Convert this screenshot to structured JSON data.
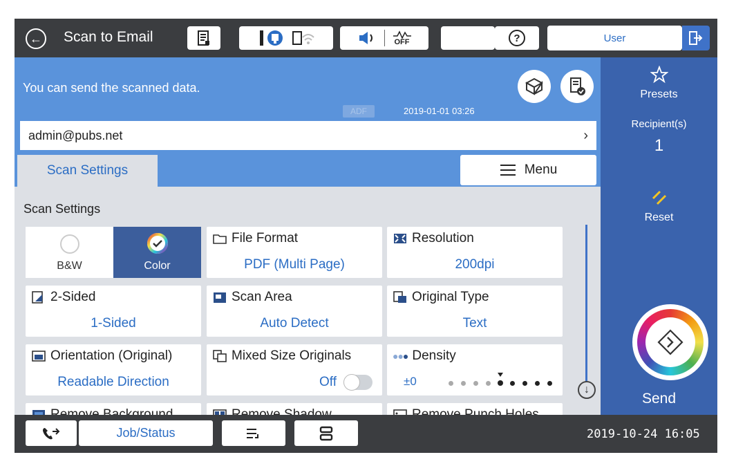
{
  "topbar": {
    "title": "Scan to Email",
    "user_label": "User",
    "icons": [
      "back-icon",
      "job-list-icon",
      "maintenance-icon",
      "wifi-icon",
      "volume-icon",
      "eco-off-icon",
      "sleep-icon",
      "help-icon",
      "logout-icon"
    ],
    "eco_off_text": "OFF"
  },
  "info": {
    "message": "You can send the scanned data.",
    "source_badge": "ADF",
    "datetime": "2019-01-01 03:26",
    "recipient": "admin@pubs.net"
  },
  "tabs": {
    "scan_settings": "Scan Settings",
    "menu": "Menu"
  },
  "settings": {
    "section_title": "Scan Settings",
    "color_mode": {
      "bw": "B&W",
      "color": "Color",
      "selected": "Color"
    },
    "tiles": [
      {
        "label": "File Format",
        "value": "PDF (Multi Page)",
        "icon": "folder-icon"
      },
      {
        "label": "Resolution",
        "value": "200dpi",
        "icon": "resolution-icon"
      },
      {
        "label": "2-Sided",
        "value": "1-Sided",
        "icon": "two-sided-icon"
      },
      {
        "label": "Scan Area",
        "value": "Auto Detect",
        "icon": "scan-area-icon"
      },
      {
        "label": "Original Type",
        "value": "Text",
        "icon": "original-type-icon"
      },
      {
        "label": "Orientation (Original)",
        "value": "Readable Direction",
        "icon": "orientation-icon"
      },
      {
        "label": "Mixed Size Originals",
        "value": "Off",
        "icon": "mixed-size-icon"
      },
      {
        "label": "Density",
        "value": "±0",
        "icon": "density-icon",
        "level_index": 4,
        "levels": 9
      },
      {
        "label": "Remove Background",
        "icon": "remove-background-icon"
      },
      {
        "label": "Remove Shadow",
        "icon": "remove-shadow-icon"
      },
      {
        "label": "Remove Punch Holes",
        "icon": "remove-punch-holes-icon"
      }
    ]
  },
  "right_panel": {
    "presets": "Presets",
    "recipients_label": "Recipient(s)",
    "recipients_count": "1",
    "reset": "Reset",
    "send": "Send"
  },
  "bottombar": {
    "job_status": "Job/Status",
    "datetime": "2019-10-24 16:05"
  },
  "colors": {
    "topbar": "#3b3d40",
    "info_panel": "#5a93db",
    "right_panel": "#3a63ad",
    "accent_text": "#2b6dc4",
    "selected_color_mode": "#3c5e9c",
    "reset_icon": "#f3c623"
  }
}
